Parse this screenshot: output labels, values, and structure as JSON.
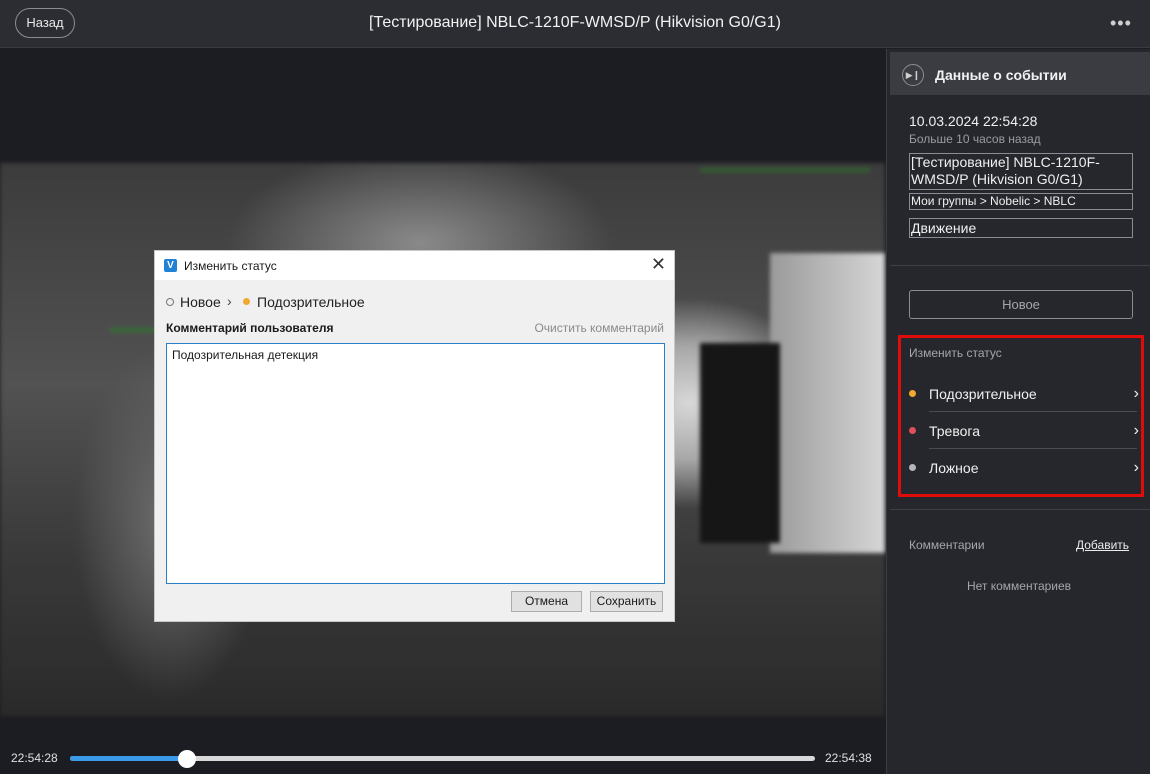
{
  "topbar": {
    "back_label": "Назад",
    "title": "[Тестирование] NBLC-1210F-WMSD/P (Hikvision G0/G1)",
    "more_icon": "more-dots-icon"
  },
  "player": {
    "time_start": "22:54:28",
    "time_end": "22:54:38",
    "progress": 0.157
  },
  "side_panel": {
    "header_title": "Данные о событии",
    "header_icon": "play-next-icon",
    "event_datetime": "10.03.2024 22:54:28",
    "event_ago": "Больше 10 часов назад",
    "camera_name": "[Тестирование] NBLC-1210F-WMSD/P (Hikvision G0/G1)",
    "group_path": "Мои группы > Nobelic > NBLC",
    "event_type": "Движение",
    "current_status_label": "Новое",
    "change_status_title": "Изменить статус",
    "statuses": [
      {
        "label": "Подозрительное",
        "color": "#f0a830"
      },
      {
        "label": "Тревога",
        "color": "#e0505a"
      },
      {
        "label": "Ложное",
        "color": "#b4b6bc"
      }
    ],
    "comments_title": "Комментарии",
    "comments_add": "Добавить",
    "no_comments": "Нет комментариев"
  },
  "dialog": {
    "title": "Изменить статус",
    "logo_letter": "V",
    "transition_from": "Новое",
    "transition_to": "Подозрительное",
    "transition_to_color": "#f0a830",
    "comment_label": "Комментарий пользователя",
    "clear_label": "Очистить комментарий",
    "comment_value": "Подозрительная детекция",
    "cancel_label": "Отмена",
    "save_label": "Сохранить"
  },
  "colors": {
    "accent": "#3b9be8",
    "highlight": "#e00c0c"
  }
}
